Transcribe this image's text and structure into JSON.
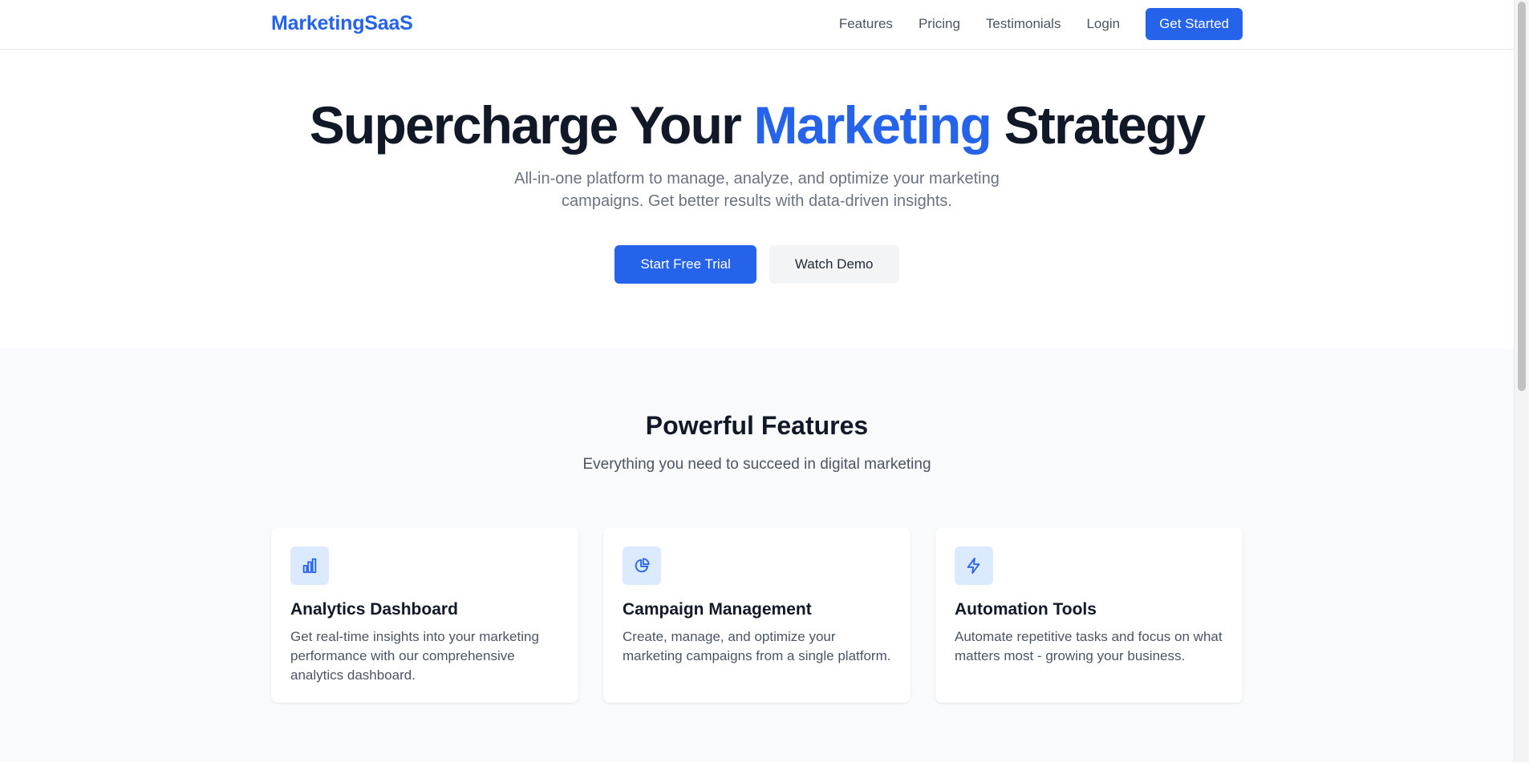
{
  "nav": {
    "brand": "MarketingSaaS",
    "links": [
      "Features",
      "Pricing",
      "Testimonials",
      "Login"
    ],
    "cta": "Get Started"
  },
  "hero": {
    "title_pre": "Supercharge Your",
    "title_accent": "Marketing",
    "title_post": "Strategy",
    "subtitle": "All-in-one platform to manage, analyze, and optimize your marketing campaigns. Get better results with data-driven insights.",
    "primary_cta": "Start Free Trial",
    "secondary_cta": "Watch Demo"
  },
  "features": {
    "title": "Powerful Features",
    "subtitle": "Everything you need to succeed in digital marketing",
    "cards": [
      {
        "icon": "bar-chart-icon",
        "title": "Analytics Dashboard",
        "description": "Get real-time insights into your marketing performance with our comprehensive analytics dashboard."
      },
      {
        "icon": "pie-chart-icon",
        "title": "Campaign Management",
        "description": "Create, manage, and optimize your marketing campaigns from a single platform."
      },
      {
        "icon": "lightning-icon",
        "title": "Automation Tools",
        "description": "Automate repetitive tasks and focus on what matters most - growing your business."
      }
    ]
  },
  "colors": {
    "accent": "#2563eb",
    "icon_bg": "#dbeafe",
    "section_bg": "#f9fafb"
  }
}
